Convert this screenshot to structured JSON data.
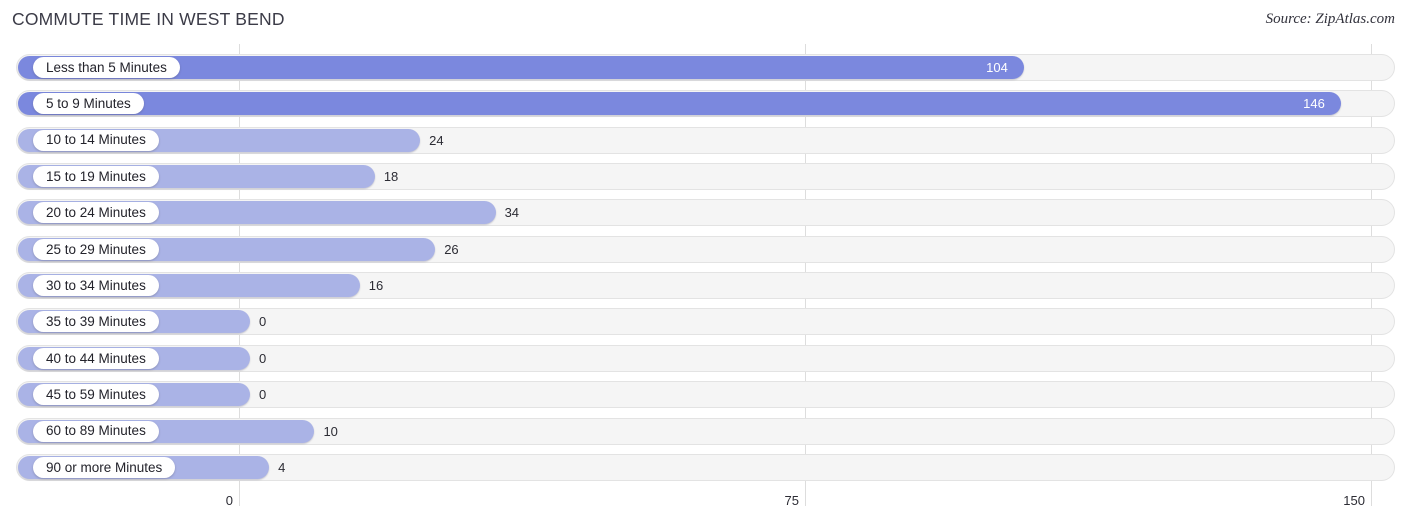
{
  "header": {
    "title": "COMMUTE TIME IN WEST BEND",
    "source": "Source: ZipAtlas.com"
  },
  "colors": {
    "bar_primary": "#7b88de",
    "bar_secondary": "#aab3e6",
    "track": "#f5f5f5",
    "track_border": "#e3e3e3",
    "gridline": "#dddddd",
    "title_text": "#3b3b47",
    "value_text_outside": "#2c2c34",
    "value_text_inside": "#ffffff"
  },
  "chart_data": {
    "type": "bar",
    "orientation": "horizontal",
    "title": "COMMUTE TIME IN WEST BEND",
    "xlabel": "",
    "ylabel": "",
    "xlim": [
      0,
      150
    ],
    "ticks": [
      "0",
      "75",
      "150"
    ],
    "tick_values": [
      0,
      75,
      150
    ],
    "grid": true,
    "legend": "none",
    "categories": [
      "Less than 5 Minutes",
      "5 to 9 Minutes",
      "10 to 14 Minutes",
      "15 to 19 Minutes",
      "20 to 24 Minutes",
      "25 to 29 Minutes",
      "30 to 34 Minutes",
      "35 to 39 Minutes",
      "40 to 44 Minutes",
      "45 to 59 Minutes",
      "60 to 89 Minutes",
      "90 or more Minutes"
    ],
    "values": [
      104,
      146,
      24,
      18,
      34,
      26,
      16,
      0,
      0,
      0,
      10,
      4
    ],
    "value_labels": [
      "104",
      "146",
      "24",
      "18",
      "34",
      "26",
      "16",
      "0",
      "0",
      "0",
      "10",
      "4"
    ]
  }
}
